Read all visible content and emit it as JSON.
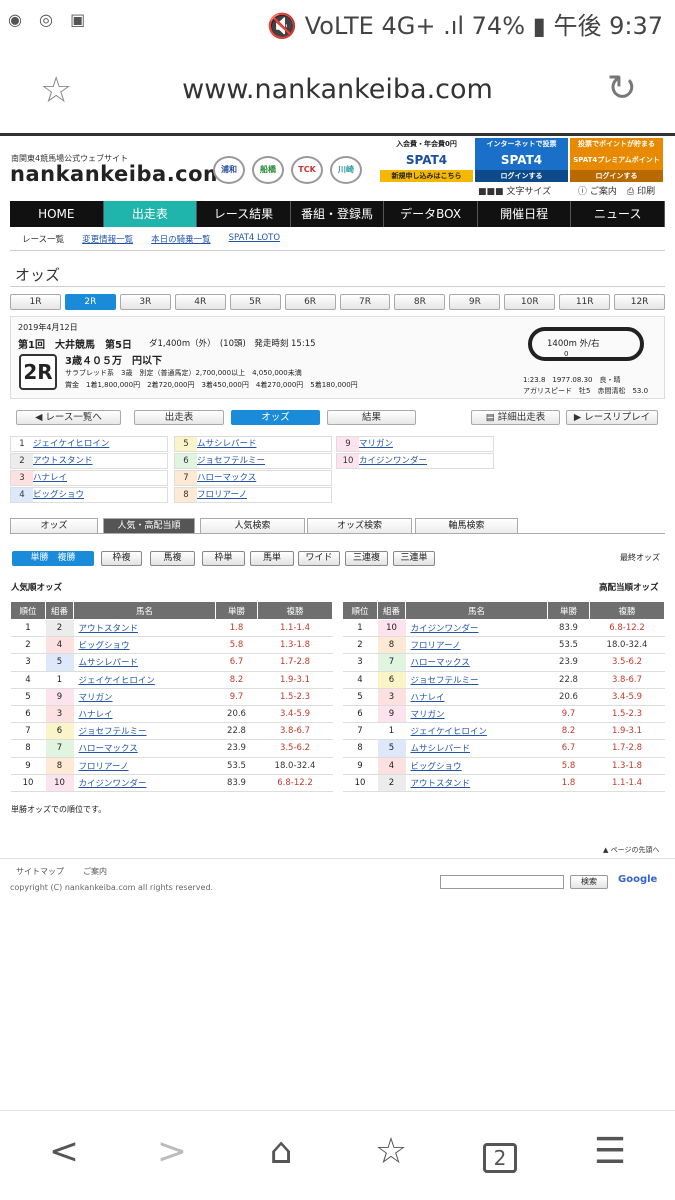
{
  "status": {
    "left_icons": "◉ ◎ ▣",
    "right": "🔇 VoLTE 4G+ .ıl 74% ▮ 午後 9:37"
  },
  "browser": {
    "url": "www.nankankeiba.com",
    "star_icon": "☆",
    "reload_icon": "↻"
  },
  "header": {
    "subtitle": "南関東4競馬場公式ウェブサイト",
    "logo": "nankankeiba.com",
    "emblems": [
      "浦和",
      "船橋",
      "TCK",
      "川崎"
    ],
    "ads": [
      {
        "t": "入会費・年会費0円",
        "m": "SPAT4",
        "b": "新規申し込みはこちら"
      },
      {
        "t": "インターネットで投票",
        "m": "SPAT4",
        "b": "ログインする"
      },
      {
        "t": "投票でポイントが貯まる",
        "m": "SPAT4プレミアムポイント",
        "b": "ログインする"
      }
    ],
    "tools": {
      "fontsize": "文字サイズ",
      "guide": "ご案内",
      "print": "印刷"
    }
  },
  "nav": [
    "HOME",
    "出走表",
    "レース結果",
    "番組・登録馬",
    "データBOX",
    "開催日程",
    "ニュース"
  ],
  "subnav": [
    "レース一覧",
    "変更情報一覧",
    "本日の騎乗一覧",
    "SPAT4 LOTO"
  ],
  "page_title": "オッズ",
  "race_tabs": [
    "1R",
    "2R",
    "3R",
    "4R",
    "5R",
    "6R",
    "7R",
    "8R",
    "9R",
    "10R",
    "11R",
    "12R"
  ],
  "race": {
    "date": "2019年4月12日",
    "meet": "第1回　大井競馬　第5日",
    "course": "ダ1,400m（外）　(10頭)　発走時刻 15:15",
    "num": "2R",
    "cls": "3歳４０５万　円以下",
    "cond": "サラブレッド系　3歳　別定（普通馬定）2,700,000以上　4,050,000未満",
    "prize": "賞金　1着1,800,000円　2着720,000円　3着450,000円　4着270,000円　5着180,000円",
    "track": "1400m 外/右",
    "track_sub": "0",
    "record": "1:23.8　1977.08.30　良・晴",
    "agari": "アガリスピード　牡5　赤間清松　53.0"
  },
  "actions": {
    "back": "レース一覧へ",
    "entries": "出走表",
    "odds": "オッズ",
    "result": "結果",
    "detail": "詳細出走表",
    "replay": "レースリプレイ"
  },
  "entries": [
    [
      "1",
      "ジェイケイヒロイン"
    ],
    [
      "2",
      "アウトスタンド"
    ],
    [
      "3",
      "ハナレイ"
    ],
    [
      "4",
      "ビッグショウ"
    ],
    [
      "5",
      "ムサシレパード"
    ],
    [
      "6",
      "ジョセフテルミー"
    ],
    [
      "7",
      "ハローマックス"
    ],
    [
      "8",
      "フロリアーノ"
    ],
    [
      "9",
      "マリガン"
    ],
    [
      "10",
      "カイジンワンダー"
    ]
  ],
  "sub_tabs": [
    "オッズ",
    "人気・高配当順",
    "人気検索",
    "オッズ検索",
    "軸馬検索"
  ],
  "bet_types": [
    "単勝　複勝",
    "枠複",
    "馬複",
    "枠単",
    "馬単",
    "ワイド",
    "三連複",
    "三連単"
  ],
  "final_odds": "最終オッズ",
  "tables": {
    "left_title": "人気順オッズ",
    "right_title": "高配当順オッズ",
    "headers": [
      "順位",
      "組番",
      "馬名",
      "単勝",
      "複勝"
    ],
    "left": [
      [
        "1",
        "2",
        "アウトスタンド",
        "1.8",
        "1.1-1.4",
        "2"
      ],
      [
        "2",
        "4",
        "ビッグショウ",
        "5.8",
        "1.3-1.8",
        "3"
      ],
      [
        "3",
        "5",
        "ムサシレパード",
        "6.7",
        "1.7-2.8",
        "4"
      ],
      [
        "4",
        "1",
        "ジェイケイヒロイン",
        "8.2",
        "1.9-3.1",
        "1"
      ],
      [
        "5",
        "9",
        "マリガン",
        "9.7",
        "1.5-2.3",
        "8"
      ],
      [
        "6",
        "3",
        "ハナレイ",
        "20.6",
        "3.4-5.9",
        "3"
      ],
      [
        "7",
        "6",
        "ジョセフテルミー",
        "22.8",
        "3.8-6.7",
        "5"
      ],
      [
        "8",
        "7",
        "ハローマックス",
        "23.9",
        "3.5-6.2",
        "6"
      ],
      [
        "9",
        "8",
        "フロリアーノ",
        "53.5",
        "18.0-32.4",
        "7"
      ],
      [
        "10",
        "10",
        "カイジンワンダー",
        "83.9",
        "6.8-12.2",
        "8"
      ]
    ],
    "right": [
      [
        "1",
        "10",
        "カイジンワンダー",
        "83.9",
        "6.8-12.2",
        "8"
      ],
      [
        "2",
        "8",
        "フロリアーノ",
        "53.5",
        "18.0-32.4",
        "7"
      ],
      [
        "3",
        "7",
        "ハローマックス",
        "23.9",
        "3.5-6.2",
        "6"
      ],
      [
        "4",
        "6",
        "ジョセフテルミー",
        "22.8",
        "3.8-6.7",
        "5"
      ],
      [
        "5",
        "3",
        "ハナレイ",
        "20.6",
        "3.4-5.9",
        "3"
      ],
      [
        "6",
        "9",
        "マリガン",
        "9.7",
        "1.5-2.3",
        "8"
      ],
      [
        "7",
        "1",
        "ジェイケイヒロイン",
        "8.2",
        "1.9-3.1",
        "1"
      ],
      [
        "8",
        "5",
        "ムサシレパード",
        "6.7",
        "1.7-2.8",
        "4"
      ],
      [
        "9",
        "4",
        "ビッグショウ",
        "5.8",
        "1.3-1.8",
        "3"
      ],
      [
        "10",
        "2",
        "アウトスタンド",
        "1.8",
        "1.1-1.4",
        "2"
      ]
    ],
    "note": "単勝オッズでの順位です。",
    "page_top": "ページの先頭へ"
  },
  "footer": {
    "sitemap": "サイトマップ",
    "guide": "ご案内",
    "copyright": "copyright (C) nankankeiba.com all rights reserved.",
    "search_btn": "検索",
    "google": "Google"
  },
  "bottom": {
    "back": "<",
    "forward": ">",
    "home": "⌂",
    "bookmark": "☆",
    "tabs": "2",
    "menu": "☰"
  }
}
